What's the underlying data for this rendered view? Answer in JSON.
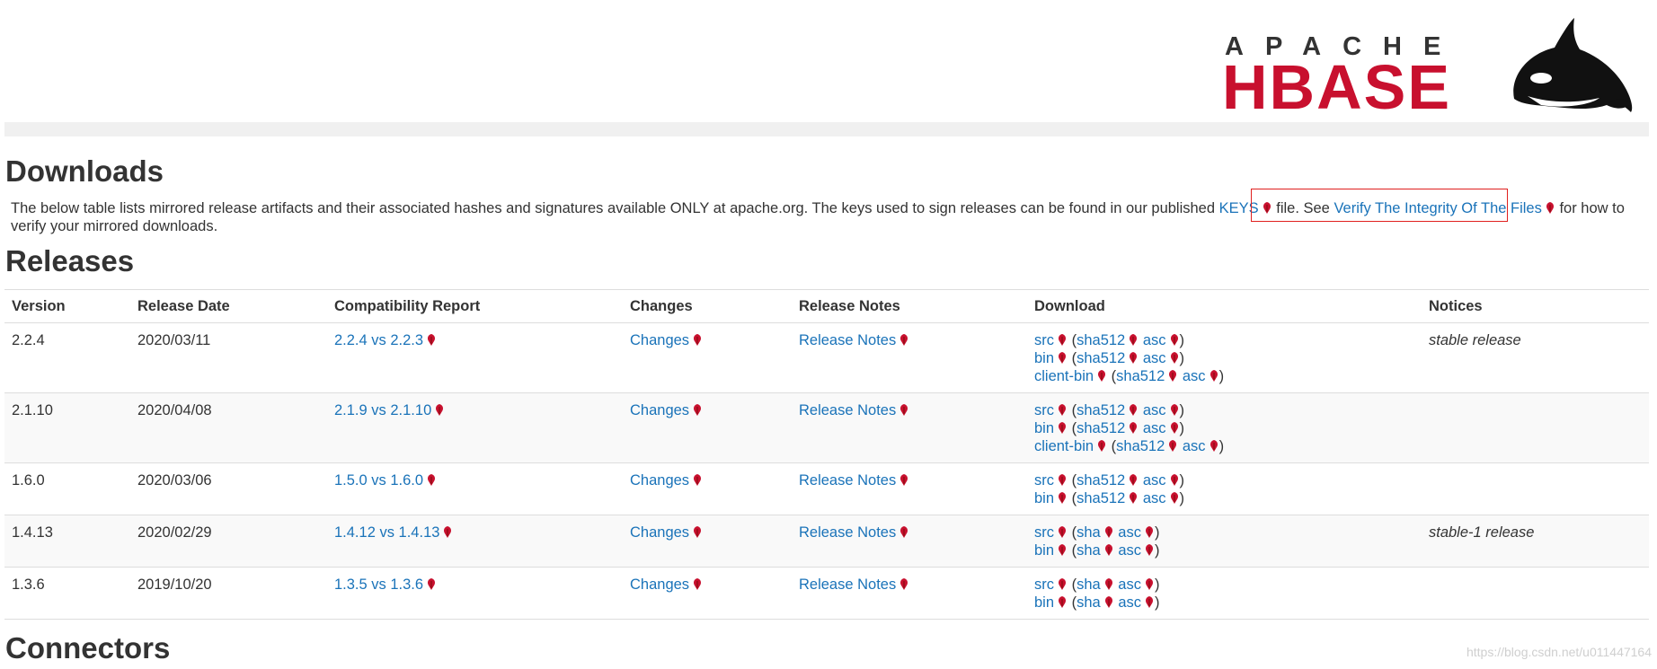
{
  "logo": {
    "apache": "APACHE",
    "hbase": "HBASE"
  },
  "downloads": {
    "title": "Downloads",
    "intro_part1": "The below table lists mirrored release artifacts and their associated hashes and signatures available ONLY at apache.org. The keys used to sign releases can be found in our published ",
    "keys_link": "KEYS",
    "intro_part2": " file. See ",
    "verify_link": "Verify The Integrity Of The Files",
    "intro_part3": " for how to verify your mirrored downloads."
  },
  "releases": {
    "title": "Releases",
    "headers": [
      "Version",
      "Release Date",
      "Compatibility Report",
      "Changes",
      "Release Notes",
      "Download",
      "Notices"
    ],
    "rows": [
      {
        "version": "2.2.4",
        "date": "2020/03/11",
        "compat": "2.2.4 vs 2.2.3",
        "changes": "Changes",
        "notes": "Release Notes",
        "downloads": [
          {
            "name": "src",
            "hash": "sha512",
            "sig": "asc"
          },
          {
            "name": "bin",
            "hash": "sha512",
            "sig": "asc"
          },
          {
            "name": "client-bin",
            "hash": "sha512",
            "sig": "asc"
          }
        ],
        "notice": "stable release"
      },
      {
        "version": "2.1.10",
        "date": "2020/04/08",
        "compat": "2.1.9 vs 2.1.10",
        "changes": "Changes",
        "notes": "Release Notes",
        "downloads": [
          {
            "name": "src",
            "hash": "sha512",
            "sig": "asc"
          },
          {
            "name": "bin",
            "hash": "sha512",
            "sig": "asc"
          },
          {
            "name": "client-bin",
            "hash": "sha512",
            "sig": "asc"
          }
        ],
        "notice": ""
      },
      {
        "version": "1.6.0",
        "date": "2020/03/06",
        "compat": "1.5.0 vs 1.6.0",
        "changes": "Changes",
        "notes": "Release Notes",
        "downloads": [
          {
            "name": "src",
            "hash": "sha512",
            "sig": "asc"
          },
          {
            "name": "bin",
            "hash": "sha512",
            "sig": "asc"
          }
        ],
        "notice": ""
      },
      {
        "version": "1.4.13",
        "date": "2020/02/29",
        "compat": "1.4.12 vs 1.4.13",
        "changes": "Changes",
        "notes": "Release Notes",
        "downloads": [
          {
            "name": "src",
            "hash": "sha",
            "sig": "asc"
          },
          {
            "name": "bin",
            "hash": "sha",
            "sig": "asc"
          }
        ],
        "notice": "stable-1 release"
      },
      {
        "version": "1.3.6",
        "date": "2019/10/20",
        "compat": "1.3.5 vs 1.3.6",
        "changes": "Changes",
        "notes": "Release Notes",
        "downloads": [
          {
            "name": "src",
            "hash": "sha",
            "sig": "asc"
          },
          {
            "name": "bin",
            "hash": "sha",
            "sig": "asc"
          }
        ],
        "notice": ""
      }
    ]
  },
  "connectors": {
    "title": "Connectors"
  },
  "watermark": "https://blog.csdn.net/u011447164",
  "colors": {
    "link": "#1a73b9",
    "logo_red": "#c8102e",
    "highlight": "#e0201f"
  },
  "icons": {
    "external_link": "feather-icon"
  }
}
